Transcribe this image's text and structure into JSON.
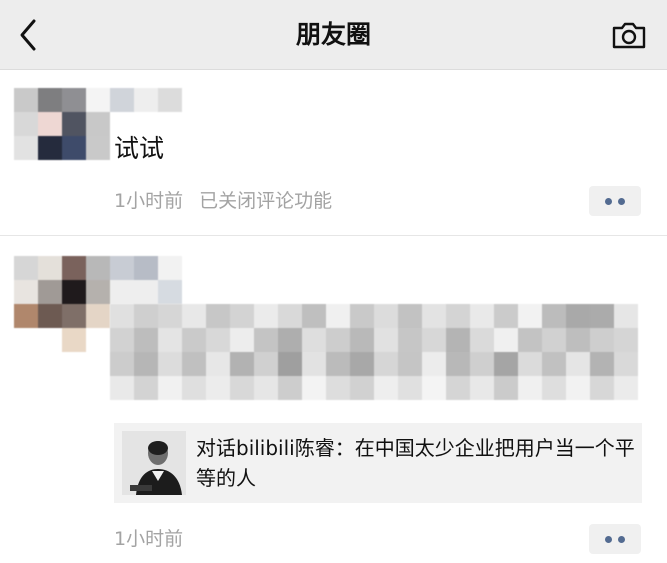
{
  "nav": {
    "title": "朋友圈"
  },
  "posts": [
    {
      "text": "试试",
      "time": "1小时前",
      "note": "已关闭评论功能"
    },
    {
      "link": {
        "title": "对话bilibili陈睿：在中国太少企业把用户当一个平等的人"
      },
      "time": "1小时前"
    }
  ],
  "colors": {
    "nav_bg": "#ededed",
    "meta_text": "#a3a3a3",
    "more_dots": "#536b91",
    "link_card_bg": "#f2f2f2"
  },
  "icons": [
    "back-icon",
    "camera-icon",
    "more-icon"
  ]
}
